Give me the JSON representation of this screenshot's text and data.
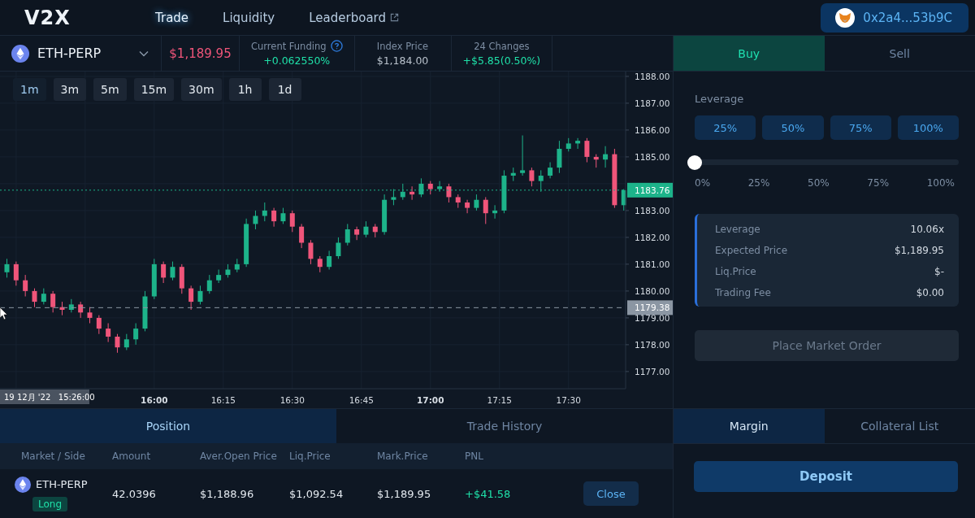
{
  "header": {
    "logo": "V2X",
    "nav": [
      {
        "label": "Trade",
        "selected": true,
        "external": false
      },
      {
        "label": "Liquidity",
        "selected": false,
        "external": false
      },
      {
        "label": "Leaderboard",
        "selected": false,
        "external": true
      }
    ],
    "wallet": "0x2a4...53b9C"
  },
  "market": {
    "symbol": "ETH-PERP",
    "price": "$1,189.95",
    "stats": [
      {
        "label": "Current Funding",
        "value": "+0.062550%",
        "color": "#1fe0a8",
        "help": true
      },
      {
        "label": "Index Price",
        "value": "$1,184.00",
        "color": "#b8c1cb",
        "help": false
      },
      {
        "label": "24 Changes",
        "value": "+$5.85(0.50%)",
        "color": "#1fe0a8",
        "help": false
      }
    ]
  },
  "chart": {
    "intervals": [
      {
        "label": "1m",
        "selected": true
      },
      {
        "label": "3m",
        "selected": false
      },
      {
        "label": "5m",
        "selected": false
      },
      {
        "label": "15m",
        "selected": false
      },
      {
        "label": "30m",
        "selected": false
      },
      {
        "label": "1h",
        "selected": false
      },
      {
        "label": "1d",
        "selected": false
      }
    ],
    "crosshair_time": "19 12月 '22   15:26:00",
    "time_tick_weights": [
      {
        "bold": true
      },
      {
        "bold": false
      },
      {
        "bold": false
      },
      {
        "bold": false
      },
      {
        "bold": true
      },
      {
        "bold": false
      },
      {
        "bold": false
      }
    ],
    "chart_data": {
      "type": "candlestick",
      "grid": true,
      "xlim": [
        926.5,
        1062.4
      ],
      "ylim": [
        1176.36,
        1188.18
      ],
      "xticks": [
        {
          "value": 960,
          "label": "16:00"
        },
        {
          "value": 975,
          "label": "16:15"
        },
        {
          "value": 990,
          "label": "16:30"
        },
        {
          "value": 1005,
          "label": "16:45"
        },
        {
          "value": 1020,
          "label": "17:00"
        },
        {
          "value": 1035,
          "label": "17:15"
        },
        {
          "value": 1050,
          "label": "17:30"
        }
      ],
      "ref_lines": [
        {
          "axis": "y",
          "value": 1183.76,
          "label": "1183.76",
          "color": "#1db38a"
        },
        {
          "axis": "y",
          "value": 1179.38,
          "label": "1179.38",
          "color": "#8b96a3"
        }
      ],
      "x": [
        928,
        930,
        932,
        934,
        936,
        938,
        940,
        942,
        944,
        946,
        948,
        950,
        952,
        954,
        956,
        958,
        960,
        962,
        964,
        966,
        968,
        970,
        972,
        974,
        976,
        978,
        980,
        982,
        984,
        986,
        988,
        990,
        992,
        994,
        996,
        998,
        1000,
        1002,
        1004,
        1006,
        1008,
        1010,
        1012,
        1014,
        1016,
        1018,
        1020,
        1022,
        1024,
        1026,
        1028,
        1030,
        1032,
        1034,
        1036,
        1038,
        1040,
        1042,
        1044,
        1046,
        1048,
        1050,
        1052,
        1054,
        1056,
        1058,
        1060,
        1062
      ],
      "ohlc": [
        [
          1180.7,
          1181.2,
          1180.5,
          1181.0
        ],
        [
          1181.0,
          1181.1,
          1180.2,
          1180.4
        ],
        [
          1180.4,
          1180.6,
          1179.8,
          1180.0
        ],
        [
          1180.0,
          1180.1,
          1179.4,
          1179.6
        ],
        [
          1179.6,
          1180.1,
          1179.5,
          1179.9
        ],
        [
          1179.9,
          1180.0,
          1179.2,
          1179.4
        ],
        [
          1179.4,
          1179.6,
          1179.1,
          1179.3
        ],
        [
          1179.3,
          1179.7,
          1179.2,
          1179.5
        ],
        [
          1179.5,
          1179.6,
          1179.0,
          1179.2
        ],
        [
          1179.2,
          1179.4,
          1178.8,
          1179.0
        ],
        [
          1179.0,
          1179.1,
          1178.4,
          1178.6
        ],
        [
          1178.6,
          1178.8,
          1178.1,
          1178.3
        ],
        [
          1178.3,
          1178.4,
          1177.7,
          1177.9
        ],
        [
          1177.9,
          1178.4,
          1177.8,
          1178.2
        ],
        [
          1178.2,
          1178.8,
          1178.0,
          1178.6
        ],
        [
          1178.6,
          1180.0,
          1178.5,
          1179.8
        ],
        [
          1179.8,
          1181.2,
          1179.7,
          1181.0
        ],
        [
          1181.0,
          1181.1,
          1180.3,
          1180.5
        ],
        [
          1180.5,
          1181.1,
          1180.4,
          1180.9
        ],
        [
          1180.9,
          1181.0,
          1179.9,
          1180.1
        ],
        [
          1180.1,
          1180.2,
          1179.3,
          1179.6
        ],
        [
          1179.6,
          1180.2,
          1179.5,
          1180.0
        ],
        [
          1180.0,
          1180.6,
          1179.9,
          1180.4
        ],
        [
          1180.4,
          1180.8,
          1180.3,
          1180.6
        ],
        [
          1180.6,
          1181.0,
          1180.5,
          1180.8
        ],
        [
          1180.8,
          1181.2,
          1180.7,
          1181.0
        ],
        [
          1181.0,
          1182.7,
          1180.9,
          1182.5
        ],
        [
          1182.5,
          1183.0,
          1182.3,
          1182.8
        ],
        [
          1182.8,
          1183.3,
          1182.6,
          1183.0
        ],
        [
          1183.0,
          1183.1,
          1182.4,
          1182.6
        ],
        [
          1182.6,
          1183.1,
          1182.5,
          1182.9
        ],
        [
          1182.9,
          1183.0,
          1182.2,
          1182.4
        ],
        [
          1182.4,
          1182.5,
          1181.6,
          1181.8
        ],
        [
          1181.8,
          1181.9,
          1181.0,
          1181.2
        ],
        [
          1181.2,
          1181.3,
          1180.7,
          1180.9
        ],
        [
          1180.9,
          1181.5,
          1180.8,
          1181.3
        ],
        [
          1181.3,
          1182.0,
          1181.2,
          1181.8
        ],
        [
          1181.8,
          1182.5,
          1181.7,
          1182.3
        ],
        [
          1182.3,
          1182.4,
          1181.9,
          1182.1
        ],
        [
          1182.1,
          1182.6,
          1182.0,
          1182.4
        ],
        [
          1182.4,
          1182.5,
          1182.0,
          1182.2
        ],
        [
          1182.2,
          1183.6,
          1182.1,
          1183.4
        ],
        [
          1183.4,
          1183.8,
          1183.2,
          1183.5
        ],
        [
          1183.5,
          1184.0,
          1183.4,
          1183.7
        ],
        [
          1183.7,
          1183.9,
          1183.4,
          1183.6
        ],
        [
          1183.6,
          1184.2,
          1183.5,
          1184.0
        ],
        [
          1184.0,
          1184.1,
          1183.6,
          1183.8
        ],
        [
          1183.8,
          1184.1,
          1183.7,
          1183.9
        ],
        [
          1183.9,
          1184.0,
          1183.3,
          1183.5
        ],
        [
          1183.5,
          1183.6,
          1183.1,
          1183.3
        ],
        [
          1183.3,
          1183.4,
          1182.9,
          1183.1
        ],
        [
          1183.1,
          1183.6,
          1183.0,
          1183.4
        ],
        [
          1183.4,
          1183.5,
          1182.5,
          1182.9
        ],
        [
          1182.9,
          1183.2,
          1182.7,
          1183.0
        ],
        [
          1183.0,
          1184.5,
          1182.9,
          1184.3
        ],
        [
          1184.3,
          1184.6,
          1184.1,
          1184.4
        ],
        [
          1184.4,
          1185.8,
          1184.3,
          1184.5
        ],
        [
          1184.5,
          1184.6,
          1183.9,
          1184.1
        ],
        [
          1184.1,
          1184.5,
          1183.7,
          1184.3
        ],
        [
          1184.3,
          1184.8,
          1184.2,
          1184.6
        ],
        [
          1184.6,
          1185.6,
          1184.4,
          1185.3
        ],
        [
          1185.3,
          1185.7,
          1185.2,
          1185.5
        ],
        [
          1185.5,
          1185.7,
          1185.3,
          1185.6
        ],
        [
          1185.6,
          1185.7,
          1184.8,
          1185.0
        ],
        [
          1185.0,
          1185.1,
          1184.6,
          1184.9
        ],
        [
          1184.9,
          1185.4,
          1184.6,
          1185.1
        ],
        [
          1185.1,
          1185.3,
          1183.1,
          1183.2
        ],
        [
          1183.2,
          1183.8,
          1183.0,
          1183.76
        ]
      ],
      "yticks": [
        {
          "value": 1188,
          "label": "1188.00"
        },
        {
          "value": 1187,
          "label": "1187.00"
        },
        {
          "value": 1186,
          "label": "1186.00"
        },
        {
          "value": 1185,
          "label": "1185.00"
        },
        {
          "value": 1183,
          "label": "1183.00"
        },
        {
          "value": 1182,
          "label": "1182.00"
        },
        {
          "value": 1181,
          "label": "1181.00"
        },
        {
          "value": 1180,
          "label": "1180.00"
        },
        {
          "value": 1179,
          "label": "1179.00"
        },
        {
          "value": 1178,
          "label": "1178.00"
        },
        {
          "value": 1177,
          "label": "1177.00"
        }
      ]
    }
  },
  "positions": {
    "tabs": [
      {
        "label": "Position",
        "selected": true
      },
      {
        "label": "Trade History",
        "selected": false
      }
    ],
    "columns": [
      "Market / Side",
      "Amount",
      "Aver.Open Price",
      "Liq.Price",
      "Mark.Price",
      "PNL"
    ],
    "rows": [
      {
        "market": "ETH-PERP",
        "side": "Long",
        "amount": "42.0396",
        "open_price": "$1,188.96",
        "liq_price": "$1,092.54",
        "mark_price": "$1,189.95",
        "pnl": "+$41.58",
        "action": "Close"
      }
    ]
  },
  "order": {
    "tabs": [
      {
        "label": "Buy",
        "selected": true
      },
      {
        "label": "Sell",
        "selected": false
      }
    ],
    "leverage_label": "Leverage",
    "presets": [
      "25%",
      "50%",
      "75%",
      "100%"
    ],
    "slider": {
      "level": 0,
      "labels": [
        "0%",
        "25%",
        "50%",
        "75%",
        "100%"
      ]
    },
    "summary": [
      {
        "label": "Leverage",
        "value": "10.06x"
      },
      {
        "label": "Expected Price",
        "value": "$1,189.95"
      },
      {
        "label": "Liq.Price",
        "value": "$-"
      },
      {
        "label": "Trading Fee",
        "value": "$0.00"
      }
    ],
    "submit": {
      "label": "Place Market Order",
      "disabled": true
    }
  },
  "margin": {
    "tabs": [
      {
        "label": "Margin",
        "selected": true
      },
      {
        "label": "Collateral List",
        "selected": false
      }
    ],
    "deposit": "Deposit"
  }
}
